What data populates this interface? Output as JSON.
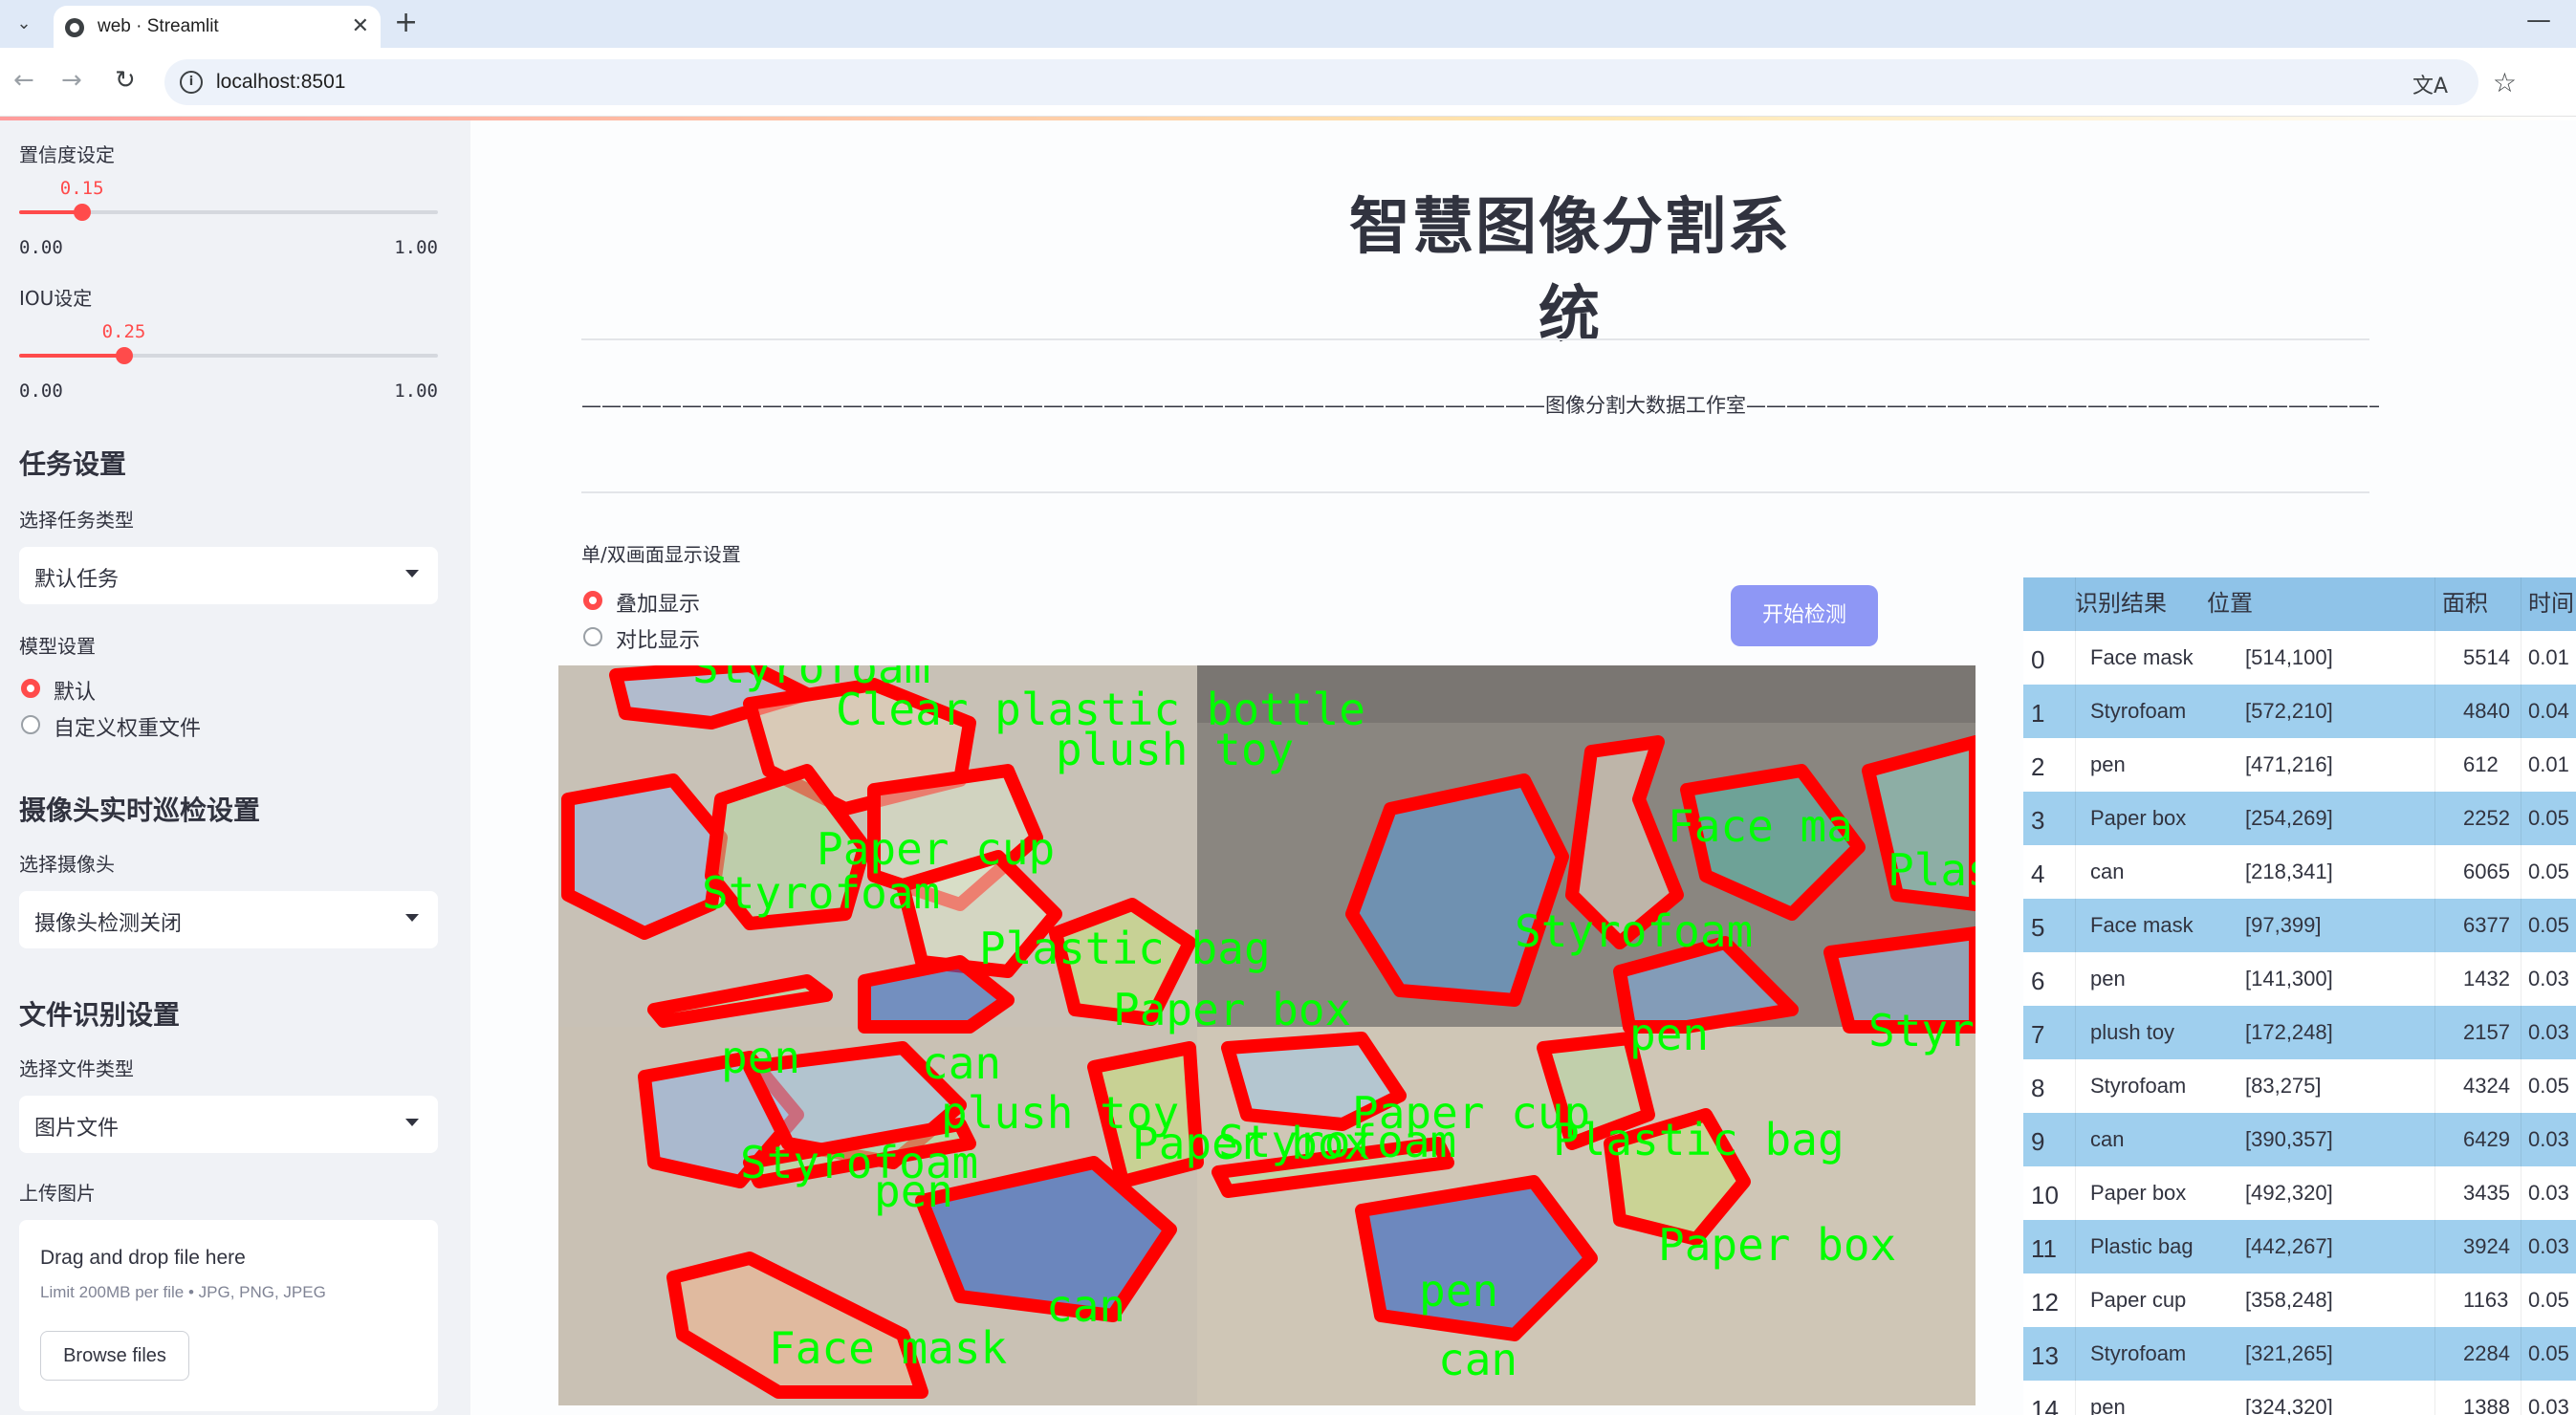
{
  "browser": {
    "tab_title": "web · Streamlit",
    "url": "localhost:8501",
    "icons": [
      "tab-list-icon",
      "streamlit-favicon",
      "close-icon",
      "plus-icon",
      "minimize-icon",
      "back-arrow-icon",
      "forward-arrow-icon",
      "reload-icon",
      "site-info-icon",
      "translate-icon",
      "star-icon"
    ]
  },
  "sidebar": {
    "confidence": {
      "label": "置信度设定",
      "value": "0.15",
      "min": "0.00",
      "max": "1.00",
      "fraction": 0.15
    },
    "iou": {
      "label": "IOU设定",
      "value": "0.25",
      "min": "0.00",
      "max": "1.00",
      "fraction": 0.25
    },
    "task_heading": "任务设置",
    "task_select_label": "选择任务类型",
    "task_select_value": "默认任务",
    "model_label": "模型设置",
    "model_options": [
      {
        "label": "默认",
        "selected": true
      },
      {
        "label": "自定义权重文件",
        "selected": false
      }
    ],
    "camera_heading": "摄像头实时巡检设置",
    "camera_select_label": "选择摄像头",
    "camera_select_value": "摄像头检测关闭",
    "file_heading": "文件识别设置",
    "file_select_label": "选择文件类型",
    "file_select_value": "图片文件",
    "upload_label": "上传图片",
    "upload_title": "Drag and drop file here",
    "upload_limit": "Limit 200MB per file • JPG, PNG, JPEG",
    "upload_button": "Browse files"
  },
  "main": {
    "title": "智慧图像分割系统",
    "banner": "————————————————————————————————————————————————图像分割大数据工作室————————————————————————————————————————————————",
    "display_label": "单/双画面显示设置",
    "display_options": [
      {
        "label": "叠加显示",
        "selected": true
      },
      {
        "label": "对比显示",
        "selected": false
      }
    ],
    "detect_button": "开始检测",
    "image_labels": [
      "Styrofoam",
      "Clear plastic bottle",
      "plush toy",
      "Paper cup",
      "Styrofoam",
      "Plastic bag",
      "pen",
      "can",
      "Paper box",
      "Face ma",
      "Plas",
      "Styrofoam",
      "pen",
      "Styro",
      "plush toy",
      "Paper cup",
      "Paper box",
      "Styrofoam",
      "Plastic bag",
      "Styrofoam",
      "pen",
      "can",
      "pen",
      "can",
      "Paper box",
      "Face mask"
    ]
  },
  "table": {
    "headers": [
      "识别结果",
      "位置",
      "面积",
      "时间"
    ],
    "rows": [
      {
        "idx": "0",
        "result": "Face mask",
        "pos": "[514,100]",
        "area": "5514",
        "time": "0.01"
      },
      {
        "idx": "1",
        "result": "Styrofoam",
        "pos": "[572,210]",
        "area": "4840",
        "time": "0.04"
      },
      {
        "idx": "2",
        "result": "pen",
        "pos": "[471,216]",
        "area": "612",
        "time": "0.01"
      },
      {
        "idx": "3",
        "result": "Paper box",
        "pos": "[254,269]",
        "area": "2252",
        "time": "0.05"
      },
      {
        "idx": "4",
        "result": "can",
        "pos": "[218,341]",
        "area": "6065",
        "time": "0.05"
      },
      {
        "idx": "5",
        "result": "Face mask",
        "pos": "[97,399]",
        "area": "6377",
        "time": "0.05"
      },
      {
        "idx": "6",
        "result": "pen",
        "pos": "[141,300]",
        "area": "1432",
        "time": "0.03"
      },
      {
        "idx": "7",
        "result": "plush toy",
        "pos": "[172,248]",
        "area": "2157",
        "time": "0.03"
      },
      {
        "idx": "8",
        "result": "Styrofoam",
        "pos": "[83,275]",
        "area": "4324",
        "time": "0.05"
      },
      {
        "idx": "9",
        "result": "can",
        "pos": "[390,357]",
        "area": "6429",
        "time": "0.03"
      },
      {
        "idx": "10",
        "result": "Paper box",
        "pos": "[492,320]",
        "area": "3435",
        "time": "0.03"
      },
      {
        "idx": "11",
        "result": "Plastic bag",
        "pos": "[442,267]",
        "area": "3924",
        "time": "0.03"
      },
      {
        "idx": "12",
        "result": "Paper cup",
        "pos": "[358,248]",
        "area": "1163",
        "time": "0.05"
      },
      {
        "idx": "13",
        "result": "Styrofoam",
        "pos": "[321,265]",
        "area": "2284",
        "time": "0.05"
      },
      {
        "idx": "14",
        "result": "pen",
        "pos": "[324,320]",
        "area": "1388",
        "time": "0.03"
      }
    ]
  },
  "colors": {
    "accent": "#ff4b4b",
    "button": "#8e97f5",
    "table_header": "#8fc3e8",
    "table_row_alt": "#9fcfee",
    "mask_outline": "#ff0000",
    "mask_label": "#00ff00"
  }
}
